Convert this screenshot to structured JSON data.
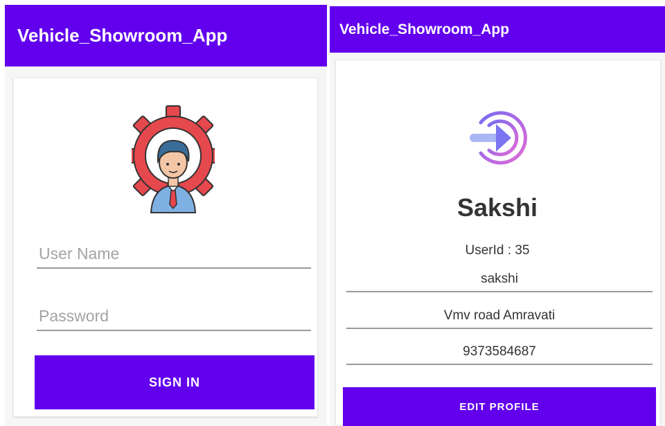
{
  "login_screen": {
    "app_title": "Vehicle_Showroom_App",
    "username_placeholder": "User Name",
    "password_placeholder": "Password",
    "signin_label": "SIGN IN",
    "logo_icon": "user-gear-icon"
  },
  "profile_screen": {
    "app_title": "Vehicle_Showroom_App",
    "header_icon": "login-arrow-icon",
    "name": "Sakshi",
    "userid_label": "UserId",
    "userid_sep": ":",
    "userid_value": "35",
    "username": "sakshi",
    "address": "Vmv road Amravati",
    "phone": "9373584687",
    "edit_label": "EDIT PROFILE"
  },
  "colors": {
    "primary": "#6200ee",
    "gear": "#e5484d",
    "avatar_hair": "#3a6d99",
    "icon_gradient_start": "#7a6bf0",
    "icon_gradient_end": "#e26ad6"
  }
}
